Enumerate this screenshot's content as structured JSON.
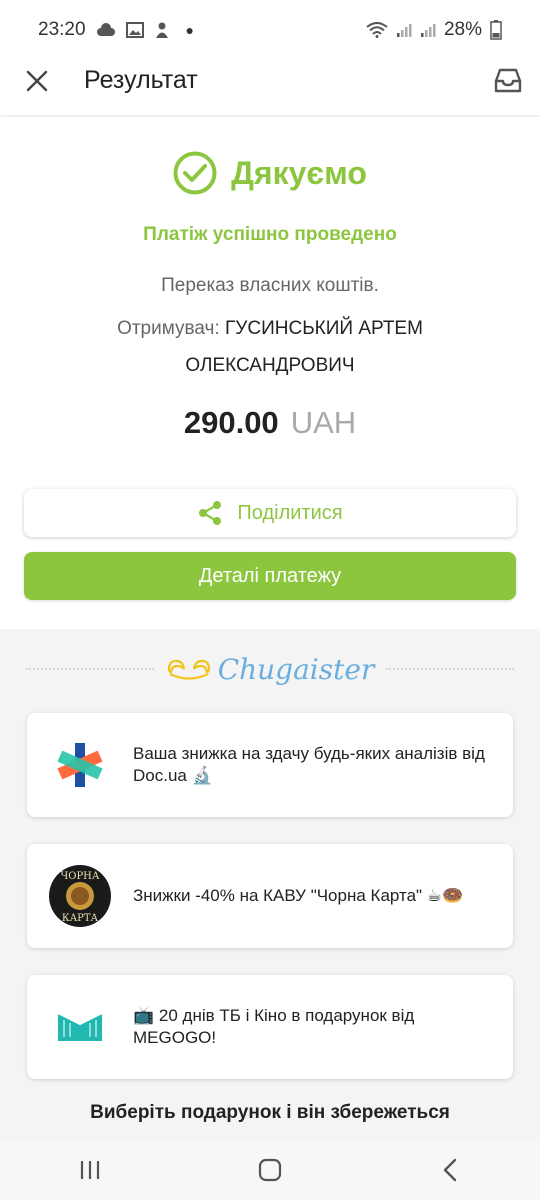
{
  "status_bar": {
    "time": "23:20",
    "battery": "28%"
  },
  "app_bar": {
    "title": "Результат"
  },
  "result": {
    "thanks": "Дякуємо",
    "success": "Платіж успішно проведено",
    "transfer": "Переказ власних коштів.",
    "recipient_label": "Отримувач:",
    "recipient_name": "ГУСИНСЬКИЙ АРТЕМ ОЛЕКСАНДРОВИЧ",
    "amount": "290.00",
    "currency": "UAH"
  },
  "buttons": {
    "share": "Поділитися",
    "details": "Деталі платежу"
  },
  "promo": {
    "brand": "Chugaister",
    "offers": [
      {
        "text": "Ваша знижка на здачу будь-яких аналізів від Doc.ua 🔬",
        "logo": "doc-ua-logo"
      },
      {
        "text": "Знижки -40% на КАВУ \"Чорна Карта\" ☕🍩",
        "logo": "chorna-karta-logo",
        "logo_top": "ЧОРНА",
        "logo_bottom": "КАРТА"
      },
      {
        "text": "📺 20 днів ТБ і Кіно в подарунок від MEGOGO!",
        "logo": "megogo-logo"
      }
    ],
    "gift": "Виберіть подарунок і він збережеться"
  },
  "colors": {
    "accent": "#8cc63f",
    "brand_blue": "#6aaee0"
  }
}
